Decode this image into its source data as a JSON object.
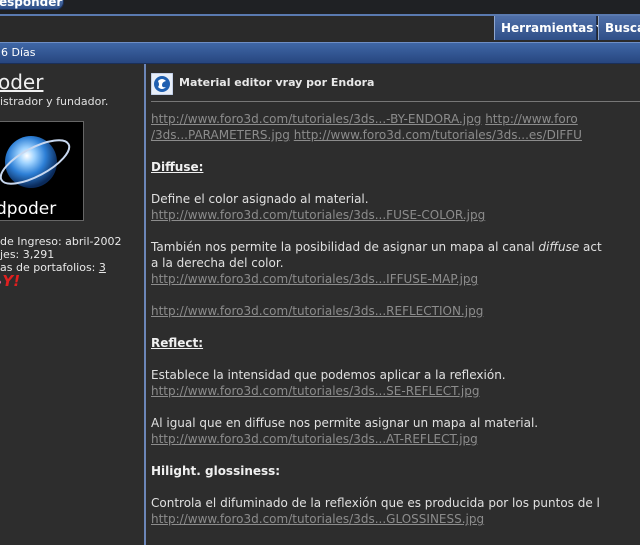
{
  "topbar": {
    "reply_label": "esponder"
  },
  "toolbar": {
    "tools_label": "Herramientas",
    "search_label": "Buscar"
  },
  "dateline": {
    "text": "6 Días"
  },
  "user": {
    "name": "oder",
    "title": "istrador y fundador.",
    "avatar_text": "dpoder",
    "join": "de Ingreso: abril-2002",
    "posts": "jes: 3,291",
    "portfolio_label": "as de portafolios:",
    "portfolio_count": "3",
    "badge": "Y!"
  },
  "post": {
    "title": "Material editor vray por Endora",
    "lines": {
      "l1a": "http://www.foro3d.com/tutoriales/3ds...-BY-ENDORA.jpg",
      "l1b": "http://www.foro",
      "l2a": "/3ds...PARAMETERS.jpg",
      "l2b": "http://www.foro3d.com/tutoriales/3ds...es/DIFFU",
      "diffuse_h": "Diffuse:",
      "diffuse_t1": "Define el color asignado al material.",
      "diffuse_l1": "http://www.foro3d.com/tutoriales/3ds...FUSE-COLOR.jpg",
      "diffuse_t2a": "También nos permite la posibilidad de asignar un mapa al canal ",
      "diffuse_t2b": "diffuse",
      "diffuse_t2c": " act",
      "diffuse_t3": "a la derecha del color.",
      "diffuse_l2": "http://www.foro3d.com/tutoriales/3ds...IFFUSE-MAP.jpg",
      "reflection_l": "http://www.foro3d.com/tutoriales/3ds...REFLECTION.jpg",
      "reflect_h": "Reflect:",
      "reflect_t1": "Establece la intensidad que podemos aplicar a la reflexión.",
      "reflect_l1": "http://www.foro3d.com/tutoriales/3ds...SE-REFLECT.jpg",
      "reflect_t2": "Al igual que en diffuse nos permite asignar un mapa al material.",
      "reflect_l2": "http://www.foro3d.com/tutoriales/3ds...AT-REFLECT.jpg",
      "gloss_h": "Hilight. glossiness:",
      "gloss_t1": "Controla el difuminado de la reflexión que es producida por los puntos de l",
      "gloss_l1": "http://www.foro3d.com/tutoriales/3ds...GLOSSINESS.jpg"
    }
  },
  "icons": {
    "tools_caret": "chevron-down-icon",
    "post_icon": "3dsmax-logo-icon"
  },
  "colors": {
    "nav_blue": "#3f67a6",
    "link_gray": "#8c8c8c",
    "panel_bg": "#2d2d2d"
  }
}
